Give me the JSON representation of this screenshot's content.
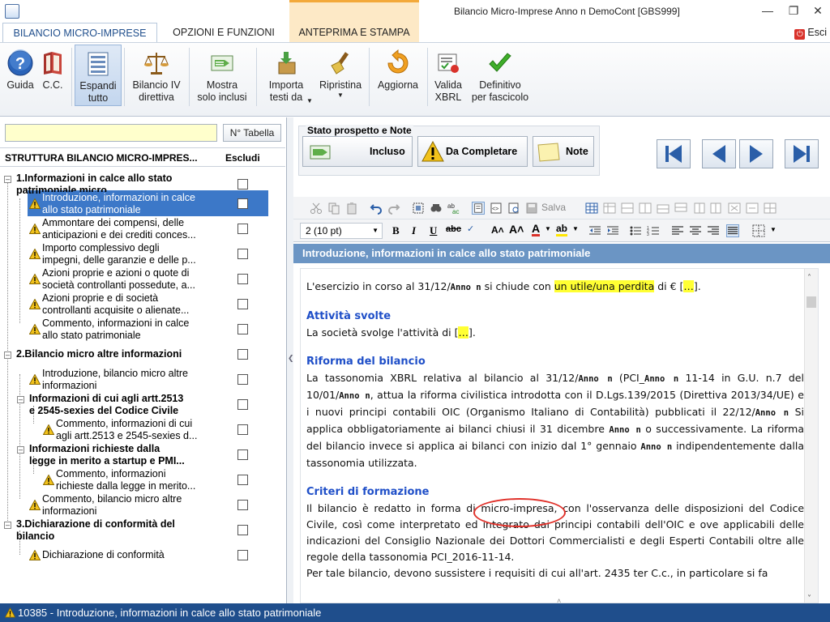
{
  "window": {
    "title": "Bilancio Micro-Imprese Anno n DemoCont [GBS999]",
    "controls": [
      "minimize",
      "restore",
      "close"
    ]
  },
  "tabs": [
    {
      "label": "BILANCIO MICRO-IMPRESE",
      "active": true
    },
    {
      "label": "OPZIONI E FUNZIONI",
      "active": false
    },
    {
      "label": "ANTEPRIMA E STAMPA",
      "active": false
    }
  ],
  "esci_label": "Esci",
  "ribbon": {
    "guida": "Guida",
    "cc": "C.C.",
    "espandi": "Espandi\ntutto",
    "bilancio": "Bilancio IV\ndirettiva",
    "mostra": "Mostra\nsolo inclusi",
    "importa": "Importa\ntesti da",
    "ripristina": "Ripristina",
    "aggiorna": "Aggiorna",
    "valida": "Valida\nXBRL",
    "definitivo": "Definitivo\nper fascicolo"
  },
  "left": {
    "search_value": "",
    "ntab_label": "N° Tabella",
    "col_structure": "STRUTTURA BILANCIO MICRO-IMPRES...",
    "col_escludi": "Escludi",
    "tree": [
      {
        "label": "1.Informazioni in calce allo stato\npatrimoniale micro",
        "bold": true
      },
      {
        "label": "Introduzione, informazioni in calce\nallo stato patrimoniale",
        "selected": true
      },
      {
        "label": "Ammontare dei compensi, delle\nanticipazioni e dei crediti conces..."
      },
      {
        "label": "Importo complessivo degli\nimpegni, delle garanzie e delle p..."
      },
      {
        "label": "Azioni proprie e azioni o quote di\nsocietà controllanti possedute, a..."
      },
      {
        "label": "Azioni proprie e di società\ncontrollanti acquisite o alienate..."
      },
      {
        "label": "Commento, informazioni in calce\nallo stato patrimoniale"
      },
      {
        "label": "2.Bilancio micro altre informazioni",
        "bold": true
      },
      {
        "label": "Introduzione, bilancio micro altre\ninformazioni"
      },
      {
        "label": "Informazioni di cui agli artt.2513\ne 2545-sexies del Codice Civile",
        "bold": true
      },
      {
        "label": "Commento, informazioni di cui\nagli artt.2513 e 2545-sexies d..."
      },
      {
        "label": "Informazioni richieste dalla\nlegge in merito a startup e PMI...",
        "bold": true
      },
      {
        "label": "Commento, informazioni\nrichieste dalla legge in merito..."
      },
      {
        "label": "Commento, bilancio micro altre\ninformazioni"
      },
      {
        "label": "3.Dichiarazione di conformità del\nbilancio",
        "bold": true
      },
      {
        "label": "Dichiarazione di conformità"
      }
    ]
  },
  "stato": {
    "caption": "Stato prospetto e Note",
    "incluso": "Incluso",
    "da_completare": "Da Completare",
    "note": "Note"
  },
  "editor": {
    "salva_label": "Salva",
    "font_size": "2 (10 pt)",
    "section_title": "Introduzione, informazioni in calce allo stato patrimoniale",
    "p1_a": "L'esercizio in corso al 31/12/",
    "anno": "Anno n",
    "p1_b": " si chiude con ",
    "p1_hl": "un utile/una perdita",
    "p1_c": " di € [",
    "ellipsis": "…",
    "p1_d": "].",
    "h_attivita": "Attività svolte",
    "p2_a": "La società svolge l'attività di [",
    "p2_b": "].",
    "h_riforma": "Riforma del bilancio",
    "p3_a": "La tassonomia XBRL relativa al bilancio al 31/12/",
    "p3_b": " (PCI_",
    "p3_c": " 11-14 in G.U. n.7 del 10/01/",
    "p3_d": ", attua la riforma civilistica introdotta con il D.Lgs.139/2015 (Direttiva 2013/34/UE) e i nuovi principi contabili OIC (Organismo Italiano di Contabilità) pubblicati il 22/12/",
    "p3_e": " Si applica obbligatoriamente ai bilanci chiusi il 31 dicembre ",
    "p3_f": " o successivamente. La riforma del bilancio invece si applica ai bilanci con inizio dal 1° gennaio ",
    "p3_g": " indipendentemente dalla tassonomia utilizzata.",
    "h_criteri": "Criteri di formazione",
    "p4_a": "Il bilancio è redatto in forma di ",
    "p4_b": "micro-impresa",
    "p4_c": ", con l'osservanza delle disposizioni del Codice Civile, così come interpretato ed integrato dai principi contabili dell'OIC e ove applicabili delle indicazioni del Consiglio Nazionale dei Dottori Commercialisti e degli Esperti Contabili oltre alle regole della tassonomia PCI_2016-11-14.",
    "p5": "Per tale bilancio, devono sussistere i requisiti di cui all'art. 2435 ter C.c., in particolare si fa"
  },
  "status_text": "10385 - Introduzione, informazioni in calce allo stato patrimoniale",
  "colors": {
    "accent": "#1f4e8c",
    "selection": "#3c78c8",
    "section_bar": "#6b95c4",
    "heading_blue": "#1f4fc8",
    "highlight_yellow": "#ffff33",
    "annotation_red": "#e0312a",
    "search_bg": "#ffffcc"
  }
}
